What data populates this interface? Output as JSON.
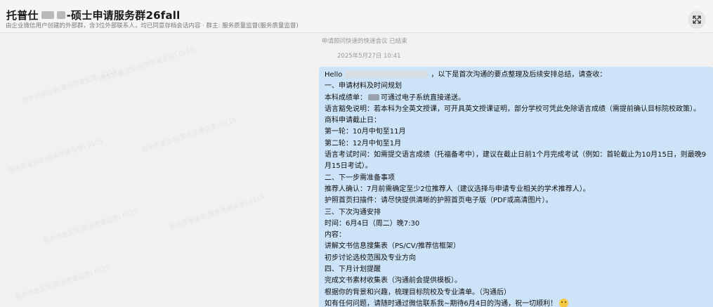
{
  "header": {
    "title_prefix": "托普仕",
    "title_mid": "-",
    "title_suffix": "硕士申请服务群26fall",
    "subtitle": "由企业微信用户创建的外部群，含3位外部联系人，均已同意存档会话内容 · 群主: 服务质量监督(服务质量监督)"
  },
  "chat": {
    "watermark_text": "服务质量监督(服务质量监督) 0115",
    "system_notice": "申请顾问快速的快速会议 已结束",
    "timestamp": "2025年5月27日 10:41",
    "message": {
      "greeting_prefix": "Hello",
      "greeting_suffix": "，以下是首次沟通的要点整理及后续安排总结，请查收：",
      "section1": "一、申请材料及时间规划",
      "transcript_prefix": "本科成绩单：",
      "transcript_suffix": "可通过电子系统直接递送。",
      "language_waiver": "语言豁免说明：若本科为全英文授课，可开具英文授课证明，部分学校可凭此免除语言成绩（需提前确认目标院校政策）。",
      "deadline_title": "商科申请截止日：",
      "round1": "第一轮：10月中旬至11月",
      "round2": "第二轮：12月中旬至1月",
      "language_exam": "语言考试时间：如需提交语言成绩（托福备考中），建议在截止日前1个月完成考试（例如：首轮截止为10月15日，则最晚9月15日考试）。",
      "section2": "二、下一步需准备事项",
      "recommender": "推荐人确认：7月前需确定至少2位推荐人（建议选择与申请专业相关的学术推荐人）。",
      "passport": "护照首页扫描件：请尽快提供清晰的护照首页电子版（PDF或高清图片）。",
      "section3": "三、下次沟通安排",
      "time": "时间：6月4日（周二）晚7:30",
      "content_title": "内容：",
      "content1": "讲解文书信息搜集表（PS/CV/推荐信框架）",
      "content2": "初步讨论选校范围及专业方向",
      "section4": "四、下月计划提醒",
      "plan1": "完成文书素材收集表（沟通前会提供模板）。",
      "plan2": "根据你的背景和兴趣，梳理目标院校及专业清单。（沟通后）",
      "closing": "如有任何问题，请随时通过微信联系我~期待6月4日的沟通，祝一切顺利！",
      "emoji_icon": "grinning-sweat-emoji"
    }
  },
  "icons": {
    "expand": "expand-arrows-icon"
  }
}
